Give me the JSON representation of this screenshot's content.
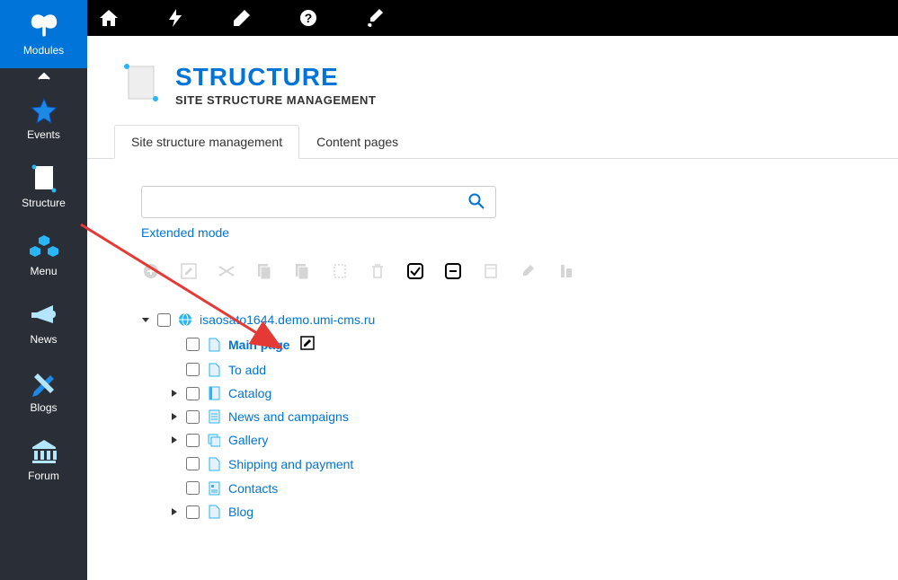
{
  "sidebar": {
    "items": [
      {
        "label": "Modules",
        "icon": "butterfly",
        "active": true
      },
      {
        "label": "Events",
        "icon": "star",
        "active": false
      },
      {
        "label": "Structure",
        "icon": "document",
        "active": false
      },
      {
        "label": "Menu",
        "icon": "cubes",
        "active": false
      },
      {
        "label": "News",
        "icon": "megaphone",
        "active": false
      },
      {
        "label": "Blogs",
        "icon": "pencils",
        "active": false
      },
      {
        "label": "Forum",
        "icon": "temple",
        "active": false
      }
    ]
  },
  "topbar": {
    "icons": [
      "home",
      "bolt",
      "pen",
      "help",
      "brush"
    ]
  },
  "header": {
    "title": "STRUCTURE",
    "subtitle": "SITE STRUCTURE MANAGEMENT"
  },
  "tabs": [
    {
      "label": "Site structure management",
      "active": true
    },
    {
      "label": "Content pages",
      "active": false
    }
  ],
  "search": {
    "placeholder": "",
    "value": "",
    "extended_mode_label": "Extended mode"
  },
  "toolbar": {
    "buttons": [
      {
        "name": "add",
        "active": false
      },
      {
        "name": "edit",
        "active": false
      },
      {
        "name": "visibility",
        "active": false
      },
      {
        "name": "copy1",
        "active": false
      },
      {
        "name": "copy2",
        "active": false
      },
      {
        "name": "virtual",
        "active": false
      },
      {
        "name": "delete",
        "active": false
      },
      {
        "name": "check",
        "active": true
      },
      {
        "name": "uncheck",
        "active": true
      },
      {
        "name": "template",
        "active": false
      },
      {
        "name": "brush",
        "active": false
      },
      {
        "name": "align",
        "active": false
      }
    ]
  },
  "tree": {
    "root": {
      "label": "isaosato1644.demo.umi-cms.ru",
      "icon": "globe",
      "expanded": true,
      "children": [
        {
          "label": "Main page",
          "icon": "page",
          "bold": true,
          "edit": true,
          "hasChildren": false
        },
        {
          "label": "To add",
          "icon": "page",
          "bold": false,
          "hasChildren": false
        },
        {
          "label": "Catalog",
          "icon": "catalog",
          "bold": false,
          "hasChildren": true
        },
        {
          "label": "News and campaigns",
          "icon": "news",
          "bold": false,
          "hasChildren": true
        },
        {
          "label": "Gallery",
          "icon": "gallery",
          "bold": false,
          "hasChildren": true
        },
        {
          "label": "Shipping and payment",
          "icon": "page",
          "bold": false,
          "hasChildren": false
        },
        {
          "label": "Contacts",
          "icon": "contacts",
          "bold": false,
          "hasChildren": false
        },
        {
          "label": "Blog",
          "icon": "page",
          "bold": false,
          "hasChildren": true
        }
      ]
    }
  }
}
